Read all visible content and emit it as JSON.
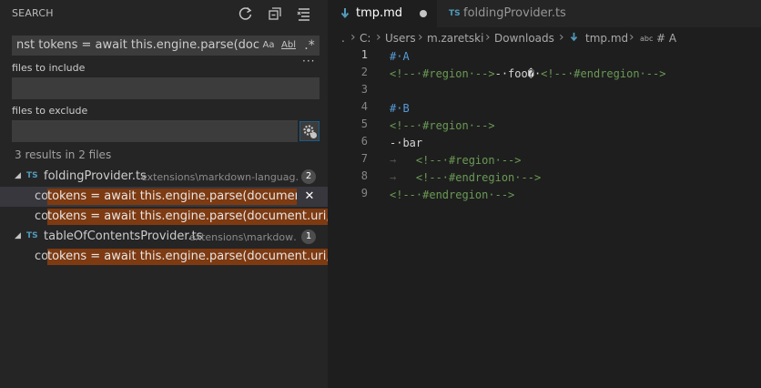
{
  "sidebar": {
    "title": "SEARCH",
    "actions": [
      {
        "name": "refresh",
        "icon": "refresh-icon"
      },
      {
        "name": "collapse-all",
        "icon": "collapse-all-icon"
      },
      {
        "name": "clear",
        "icon": "clear-results-icon"
      }
    ],
    "search": {
      "value": "nst tokens = await this.engine.parse(docum…",
      "match_case_label": "Aa",
      "whole_word_label": "Abl",
      "regex_label": ".*"
    },
    "more_label": "···",
    "include": {
      "label": "files to include",
      "value": ""
    },
    "exclude": {
      "label": "files to exclude",
      "value": ""
    },
    "results_message": "3 results in 2 files",
    "files": [
      {
        "icon_label": "TS",
        "name": "foldingProvider.ts",
        "path": "extensions\\markdown-languag…",
        "count": "2",
        "matches": [
          {
            "pre": "const",
            "rest": " tokens = await this.engine.parse(documen…",
            "selected": true
          },
          {
            "pre": "const",
            "rest": " tokens = await this.engine.parse(document.uri, …",
            "selected": false
          }
        ]
      },
      {
        "icon_label": "TS",
        "name": "tableOfContentsProvider.ts",
        "path": "extensions\\markdow…",
        "count": "1",
        "matches": [
          {
            "pre": "const",
            "rest": " tokens = await this.engine.parse(document.uri, …",
            "selected": false
          }
        ]
      }
    ],
    "remove_label": "✕"
  },
  "tabs": [
    {
      "label": "tmp.md",
      "active": true,
      "dirty": true
    },
    {
      "label": "foldingProvider.ts",
      "icon_label": "TS",
      "active": false
    }
  ],
  "breadcrumbs": {
    "root": ".",
    "segments": [
      "C:",
      "Users",
      "m.zaretski",
      "Downloads",
      "tmp.md"
    ],
    "symbol_icon": "abc",
    "symbol": "# A"
  },
  "editor": {
    "line_numbers": [
      "1",
      "2",
      "3",
      "4",
      "5",
      "6",
      "7",
      "8",
      "9"
    ],
    "current_line": 1
  },
  "colors": {
    "accent": "#519aba",
    "match_highlight": "#7e3a11",
    "comment": "#6a9955",
    "heading": "#569cd6"
  }
}
